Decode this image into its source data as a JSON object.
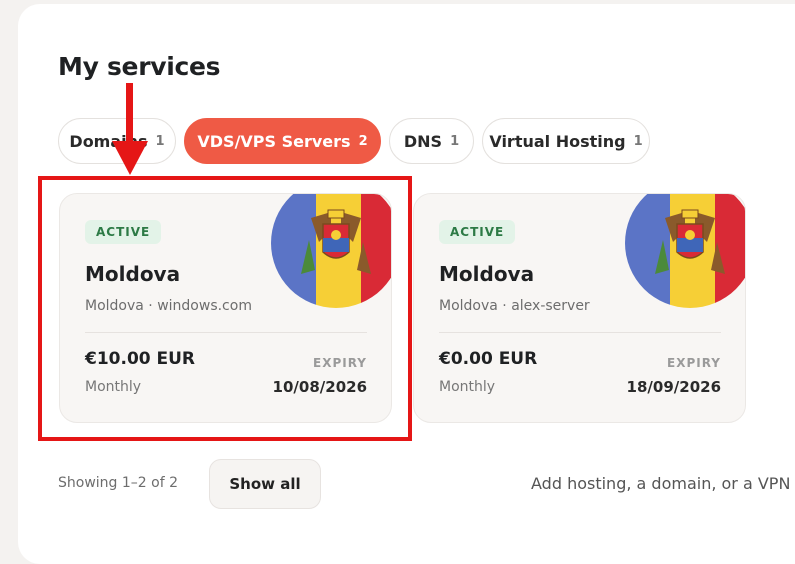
{
  "section": {
    "title": "My services"
  },
  "tabs": [
    {
      "label": "Domains",
      "count": "1"
    },
    {
      "label": "VDS/VPS Servers",
      "count": "2"
    },
    {
      "label": "DNS",
      "count": "1"
    },
    {
      "label": "Virtual Hosting",
      "count": "1"
    }
  ],
  "active_tab": "VDS/VPS Servers",
  "services": [
    {
      "status": "ACTIVE",
      "name": "Moldova",
      "subtitle": "Moldova · windows.com",
      "price": "€10.00 EUR",
      "period": "Monthly",
      "expiry_label": "EXPIRY",
      "expiry_date": "10/08/2026",
      "flag_icon": "moldova-flag-icon"
    },
    {
      "status": "ACTIVE",
      "name": "Moldova",
      "subtitle": "Moldova · alex-server",
      "price": "€0.00 EUR",
      "period": "Monthly",
      "expiry_label": "EXPIRY",
      "expiry_date": "18/09/2026",
      "flag_icon": "moldova-flag-icon"
    }
  ],
  "footer": {
    "showing": "Showing 1–2 of 2",
    "show_all": "Show all",
    "add_hint": "Add hosting, a domain, or a VPN –"
  },
  "colors": {
    "accent": "#ef5a45",
    "badge_bg": "#e3f3e8",
    "badge_text": "#2c7a45",
    "annotation": "#e51616"
  }
}
